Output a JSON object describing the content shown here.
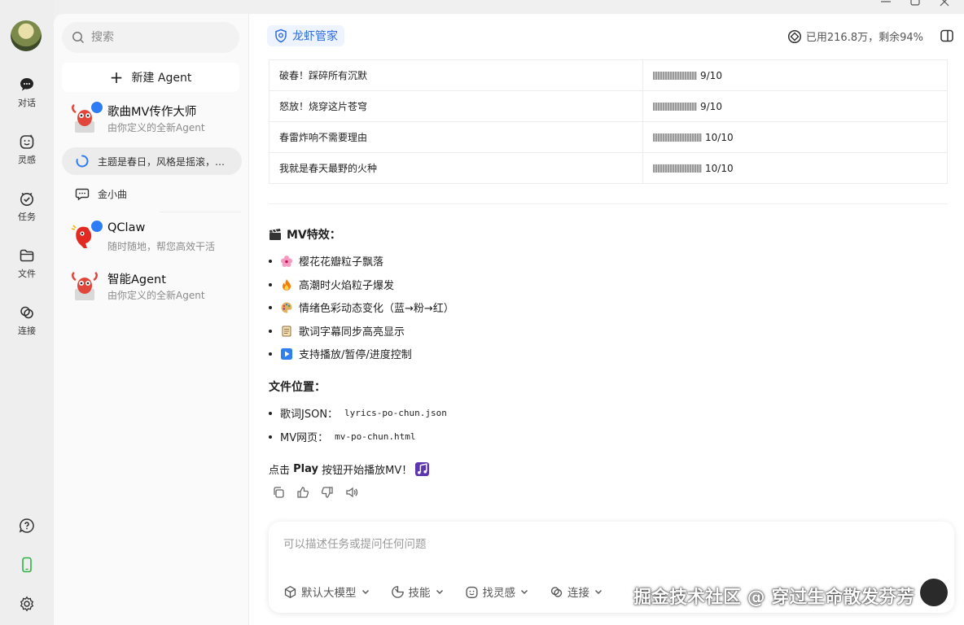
{
  "rail": {
    "items": [
      {
        "label": "对话",
        "icon": "chat-bubble-icon"
      },
      {
        "label": "灵感",
        "icon": "smile-spark-icon"
      },
      {
        "label": "任务",
        "icon": "task-check-icon"
      },
      {
        "label": "文件",
        "icon": "folder-icon"
      },
      {
        "label": "连接",
        "icon": "link-rings-icon"
      }
    ],
    "bottom_icons": [
      "help-icon",
      "phone-icon",
      "settings-gear-icon"
    ]
  },
  "sidebar": {
    "search_placeholder": "搜索",
    "new_agent_label": "新建 Agent",
    "agents": [
      {
        "name": "歌曲MV传作大师",
        "desc": "由你定义的全新Agent"
      },
      {
        "name": "QClaw",
        "desc": "随时随地，帮您高效干活"
      },
      {
        "name": "智能Agent",
        "desc": "由你定义的全新Agent"
      }
    ],
    "sessions": [
      {
        "text": "主题是春日，风格是摇滚，…",
        "icon": "loading-spinner-icon"
      },
      {
        "text": "金小曲",
        "icon": "chat-outline-icon"
      }
    ]
  },
  "header": {
    "tag": "龙虾管家",
    "quota": "已用216.8万，剩余94%"
  },
  "lyrics_table": {
    "rows": [
      {
        "line": "破春！踩碎所有沉默",
        "score": "9/10",
        "fill": 0.9
      },
      {
        "line": "怒放！烧穿这片苍穹",
        "score": "9/10",
        "fill": 0.9
      },
      {
        "line": "春雷炸响不需要理由",
        "score": "10/10",
        "fill": 1.0
      },
      {
        "line": "我就是春天最野的火种",
        "score": "10/10",
        "fill": 1.0
      }
    ]
  },
  "effects": {
    "title": "MV特效：",
    "title_icon": "clapperboard-icon",
    "items": [
      {
        "text": "樱花花瓣粒子飘落",
        "icon": "cherry-blossom-icon"
      },
      {
        "text": "高潮时火焰粒子爆发",
        "icon": "fire-icon"
      },
      {
        "text": "情绪色彩动态变化（蓝→粉→红）",
        "icon": "palette-icon"
      },
      {
        "text": "歌词字幕同步高亮显示",
        "icon": "scroll-icon"
      },
      {
        "text": "支持播放/暂停/进度控制",
        "icon": "play-button-icon"
      }
    ]
  },
  "files": {
    "title": "文件位置：",
    "items": [
      {
        "label": "歌词JSON：",
        "path": "lyrics-po-chun.json"
      },
      {
        "label": "MV网页：",
        "path": "mv-po-chun.html"
      }
    ]
  },
  "closing": {
    "prefix": "点击 ",
    "bold": "Play",
    "suffix": " 按钮开始播放MV！"
  },
  "input": {
    "placeholder": "可以描述任务或提问任何问题",
    "tools": [
      {
        "label": "默认大模型",
        "icon": "cube-icon"
      },
      {
        "label": "技能",
        "icon": "skill-leaf-icon"
      },
      {
        "label": "找灵感",
        "icon": "smile-spark-icon"
      },
      {
        "label": "连接",
        "icon": "link-rings-icon"
      }
    ]
  },
  "watermark": "掘金技术社区 @ 穿过生命散发芬芳",
  "colors": {
    "accent": "#2e7cf6",
    "tag_bg": "#eef4ff"
  }
}
